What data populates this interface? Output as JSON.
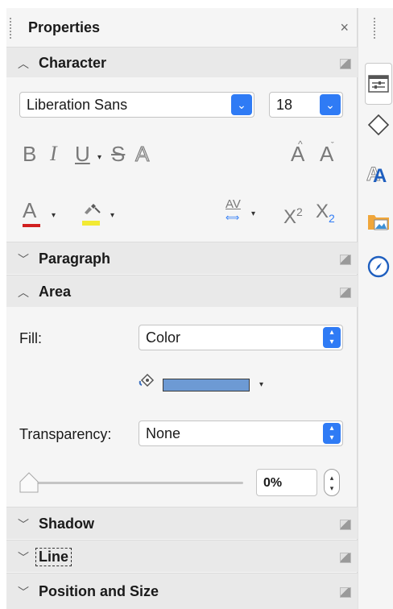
{
  "title": "Properties",
  "close_glyph": "×",
  "character": {
    "header": "Character",
    "font_name": "Liberation Sans",
    "font_size": "18",
    "bold": "B",
    "italic": "I",
    "underline": "U",
    "strikethrough": "S",
    "shadow": "A",
    "grow_font": "A",
    "shrink_font": "A",
    "font_color_glyph": "A",
    "font_color_hex": "#d11f1f",
    "highlight_hex": "#f2ea33",
    "spacing_glyph": "AV",
    "superscript": "X",
    "superscript_mark": "2",
    "subscript": "X",
    "subscript_mark": "2"
  },
  "paragraph": {
    "header": "Paragraph"
  },
  "area": {
    "header": "Area",
    "fill_label": "Fill:",
    "fill_value": "Color",
    "fill_color_hex": "#6d9ad4",
    "transparency_label": "Transparency:",
    "transparency_value": "None",
    "transparency_percent": "0%",
    "slider_value": 0
  },
  "shadow": {
    "header": "Shadow"
  },
  "line": {
    "header": "Line"
  },
  "position_size": {
    "header": "Position and Size"
  },
  "accent_hex": "#2f7bf5",
  "rail": {
    "icons": [
      "properties-icon",
      "shapes-icon",
      "styles-icon",
      "gallery-icon",
      "navigator-icon"
    ]
  }
}
